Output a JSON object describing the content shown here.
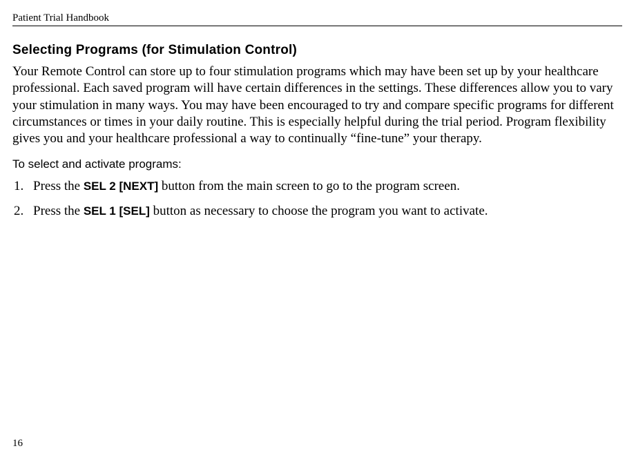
{
  "header": {
    "title": "Patient Trial Handbook"
  },
  "section": {
    "title": "Selecting Programs (for Stimulation Control)",
    "body": "Your Remote Control can store up to four stimulation programs which may have been set up by your healthcare professional. Each saved program will have certain differences in the settings. These differences allow you to vary your stimulation in many ways. You may have been encouraged to try and compare specific programs for different circumstances or times in your daily routine. This is especially helpful during the trial period. Program flexibility gives you and your healthcare professional a way to continually “fine-tune” your therapy.",
    "subheading": "To select and activate programs:",
    "steps": [
      {
        "num": "1.",
        "pre": "Press the ",
        "bold": "SEL 2 [NEXT]",
        "post": " button from the main screen to go to the program screen."
      },
      {
        "num": "2.",
        "pre": "Press the ",
        "bold": "SEL 1 [SEL]",
        "post": " button as necessary to choose the program you want to activate."
      }
    ]
  },
  "page_number": "16"
}
